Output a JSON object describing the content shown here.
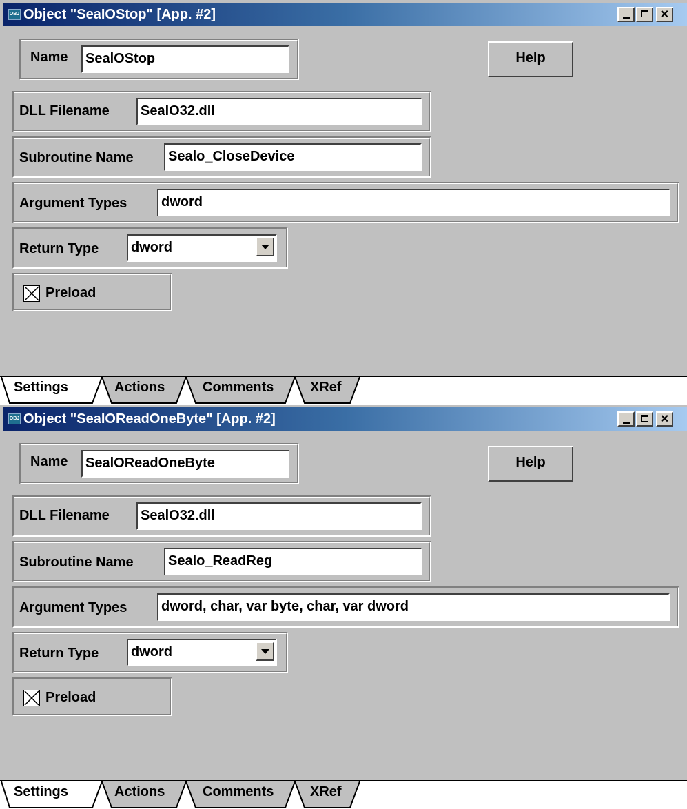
{
  "windows": [
    {
      "title": "Object \"SeaIOStop\" [App. #2]",
      "icon_text": "OBJ",
      "fields": {
        "name_label": "Name",
        "name_value": "SealOStop",
        "help_label": "Help",
        "dll_label": "DLL Filename",
        "dll_value": "SealO32.dll",
        "sub_label": "Subroutine Name",
        "sub_value": "Sealo_CloseDevice",
        "arg_label": "Argument Types",
        "arg_value": "dword",
        "ret_label": "Return Type",
        "ret_value": "dword",
        "preload_label": "Preload",
        "preload_checked": true
      },
      "tabs": [
        "Settings",
        "Actions",
        "Comments",
        "XRef"
      ],
      "active_tab": "Settings"
    },
    {
      "title": "Object \"SeaIOReadOneByte\" [App. #2]",
      "icon_text": "OBJ",
      "fields": {
        "name_label": "Name",
        "name_value": "SealOReadOneByte",
        "help_label": "Help",
        "dll_label": "DLL Filename",
        "dll_value": "SealO32.dll",
        "sub_label": "Subroutine Name",
        "sub_value": "Sealo_ReadReg",
        "arg_label": "Argument Types",
        "arg_value": "dword, char, var byte, char, var dword",
        "ret_label": "Return Type",
        "ret_value": "dword",
        "preload_label": "Preload",
        "preload_checked": true
      },
      "tabs": [
        "Settings",
        "Actions",
        "Comments",
        "XRef"
      ],
      "active_tab": "Settings"
    }
  ],
  "colors": {
    "title_gradient_start": "#0a246a",
    "title_gradient_end": "#a6caf0",
    "face": "#c0c0c0"
  },
  "icons": {
    "minimize": "minimize-icon",
    "maximize": "maximize-icon",
    "close": "close-icon",
    "dropdown": "chevron-down-icon",
    "checkbox": "checkbox-x-icon"
  }
}
